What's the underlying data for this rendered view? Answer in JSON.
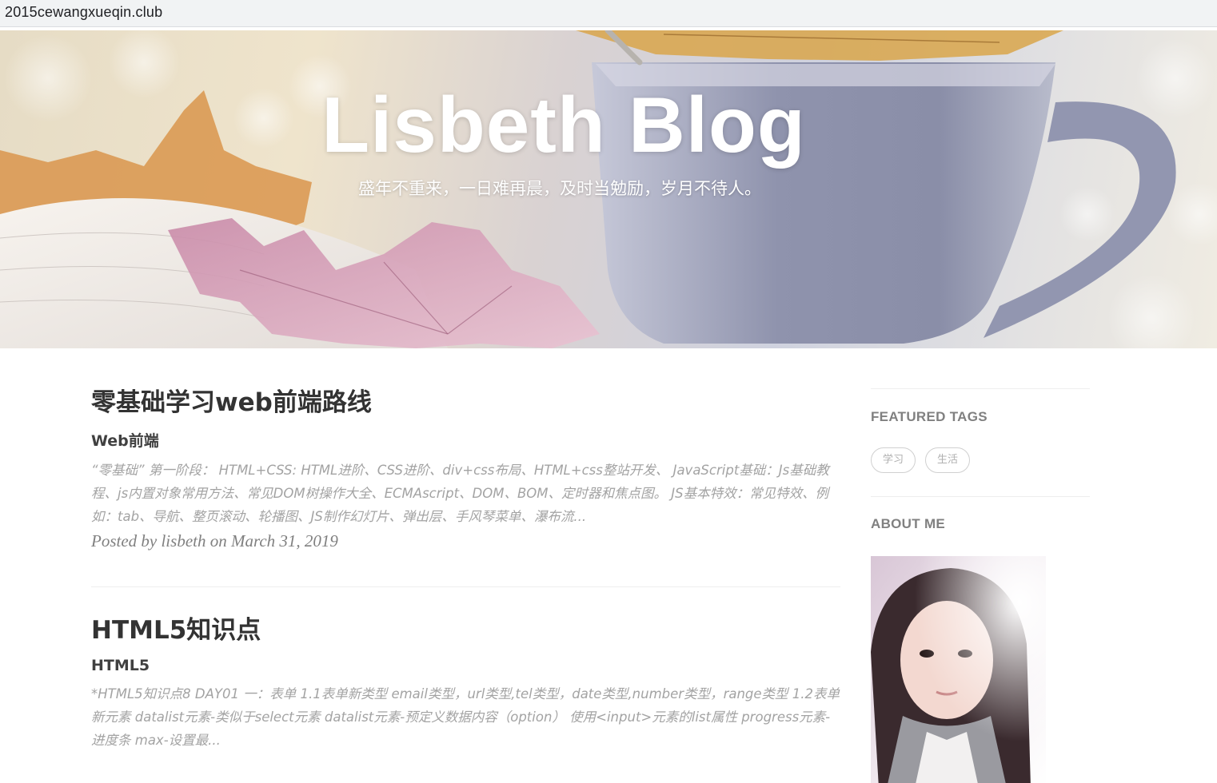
{
  "browser": {
    "url": "2015cewangxueqin.club"
  },
  "header": {
    "title": "Lisbeth Blog",
    "subtitle": "盛年不重来，一日难再晨，及时当勉励，岁月不待人。"
  },
  "posts": [
    {
      "title": "零基础学习web前端路线",
      "subtitle": "Web前端",
      "excerpt": "“零基础” 第一阶段： HTML+CSS: HTML进阶、CSS进阶、div+css布局、HTML+css整站开发、 JavaScript基础：Js基础教程、js内置对象常用方法、常见DOM树操作大全、ECMAscript、DOM、BOM、定时器和焦点图。 JS基本特效：常见特效、例如：tab、导航、整页滚动、轮播图、JS制作幻灯片、弹出层、手风琴菜单、瀑布流...",
      "meta": "Posted by lisbeth on March 31, 2019"
    },
    {
      "title": "HTML5知识点",
      "subtitle": "HTML5",
      "excerpt": "*HTML5知识点8 DAY01 一：表单 1.1表单新类型 email类型，url类型,tel类型，date类型,number类型，range类型 1.2表单新元素 datalist元素-类似于select元素 datalist元素-预定义数据内容（option） 使用<input>元素的list属性 progress元素-进度条 max-设置最..."
    }
  ],
  "sidebar": {
    "featured_tags_heading": "FEATURED TAGS",
    "tags": [
      "学习",
      "生活"
    ],
    "about_heading": "ABOUT ME"
  }
}
